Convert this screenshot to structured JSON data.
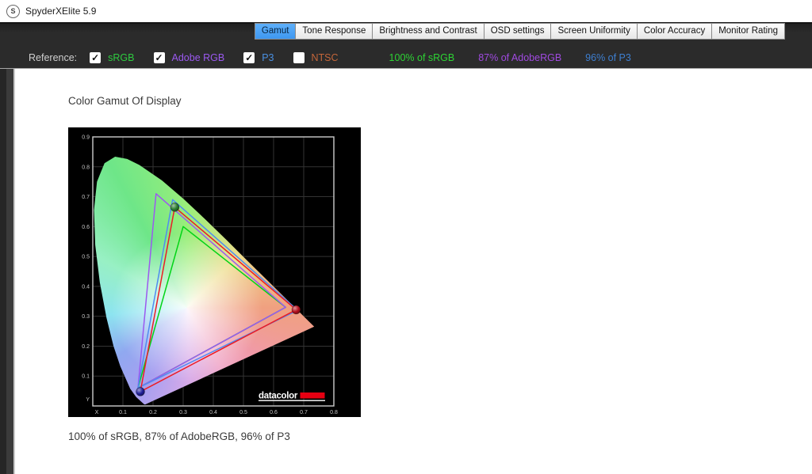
{
  "window": {
    "title": "SpyderXElite 5.9",
    "app_icon": "S"
  },
  "tabs": [
    {
      "label": "Gamut",
      "selected": true
    },
    {
      "label": "Tone Response",
      "selected": false
    },
    {
      "label": "Brightness and Contrast",
      "selected": false
    },
    {
      "label": "OSD settings",
      "selected": false
    },
    {
      "label": "Screen Uniformity",
      "selected": false
    },
    {
      "label": "Color Accuracy",
      "selected": false
    },
    {
      "label": "Monitor Rating",
      "selected": false
    }
  ],
  "toolbar": {
    "reference_label": "Reference:",
    "references": [
      {
        "label": "sRGB",
        "checked": true,
        "color": "#2ecc40"
      },
      {
        "label": "Adobe RGB",
        "checked": true,
        "color": "#9b59f0"
      },
      {
        "label": "P3",
        "checked": true,
        "color": "#4a90e2"
      },
      {
        "label": "NTSC",
        "checked": false,
        "color": "#c4663a"
      }
    ],
    "results": [
      {
        "label": "100% of sRGB",
        "color": "#2dd434"
      },
      {
        "label": "87% of AdobeRGB",
        "color": "#a04ae0"
      },
      {
        "label": "96% of P3",
        "color": "#3e7fd0"
      }
    ]
  },
  "main": {
    "heading": "Color Gamut Of Display",
    "caption": "100% of sRGB, 87% of AdobeRGB, 96% of P3"
  },
  "chart_data": {
    "type": "area",
    "subtype": "cie-1931-chromaticity-diagram",
    "title": "Color Gamut Of Display",
    "xlabel": "X",
    "ylabel": "Y",
    "xlim": [
      0,
      0.8
    ],
    "ylim": [
      0,
      0.9
    ],
    "xticks": [
      0.1,
      0.2,
      0.3,
      0.4,
      0.5,
      0.6,
      0.7,
      0.8
    ],
    "yticks": [
      0.1,
      0.2,
      0.3,
      0.4,
      0.5,
      0.6,
      0.7,
      0.8,
      0.9
    ],
    "grid": true,
    "background": "#000000",
    "grid_color": "#333333",
    "series": [
      {
        "name": "sRGB",
        "color": "#00d416",
        "points": [
          [
            0.64,
            0.33
          ],
          [
            0.3,
            0.6
          ],
          [
            0.15,
            0.06
          ]
        ]
      },
      {
        "name": "Adobe RGB",
        "color": "#9b59f0",
        "points": [
          [
            0.64,
            0.33
          ],
          [
            0.21,
            0.71
          ],
          [
            0.15,
            0.06
          ]
        ]
      },
      {
        "name": "P3",
        "color": "#4f8cf0",
        "points": [
          [
            0.68,
            0.32
          ],
          [
            0.265,
            0.69
          ],
          [
            0.15,
            0.06
          ]
        ]
      },
      {
        "name": "Display",
        "color": "#ec1c24",
        "points": [
          [
            0.675,
            0.322
          ],
          [
            0.272,
            0.665
          ],
          [
            0.158,
            0.048
          ]
        ]
      }
    ],
    "markers": [
      {
        "name": "display-green-primary",
        "x": 0.272,
        "y": 0.665,
        "color": "#2e7d32"
      },
      {
        "name": "display-red-primary",
        "x": 0.675,
        "y": 0.322,
        "color": "#b3101e"
      },
      {
        "name": "display-blue-primary",
        "x": 0.158,
        "y": 0.048,
        "color": "#20209a"
      }
    ],
    "spectral_locus": [
      [
        0.1741,
        0.005
      ],
      [
        0.1714,
        0.0051
      ],
      [
        0.1644,
        0.0109
      ],
      [
        0.144,
        0.0297
      ],
      [
        0.1241,
        0.0578
      ],
      [
        0.0913,
        0.1327
      ],
      [
        0.0687,
        0.2007
      ],
      [
        0.0454,
        0.295
      ],
      [
        0.0235,
        0.4127
      ],
      [
        0.0082,
        0.5384
      ],
      [
        0.0039,
        0.6548
      ],
      [
        0.0139,
        0.7502
      ],
      [
        0.0389,
        0.812
      ],
      [
        0.0743,
        0.8338
      ],
      [
        0.1142,
        0.8262
      ],
      [
        0.1547,
        0.8059
      ],
      [
        0.2296,
        0.7543
      ],
      [
        0.3016,
        0.6923
      ],
      [
        0.3731,
        0.6245
      ],
      [
        0.4441,
        0.5547
      ],
      [
        0.5125,
        0.4866
      ],
      [
        0.5752,
        0.4242
      ],
      [
        0.627,
        0.3725
      ],
      [
        0.6658,
        0.334
      ],
      [
        0.6915,
        0.3083
      ],
      [
        0.719,
        0.2809
      ],
      [
        0.7347,
        0.2653
      ]
    ],
    "logo_text": "datacolor",
    "logo_accent_color": "#e60012"
  }
}
